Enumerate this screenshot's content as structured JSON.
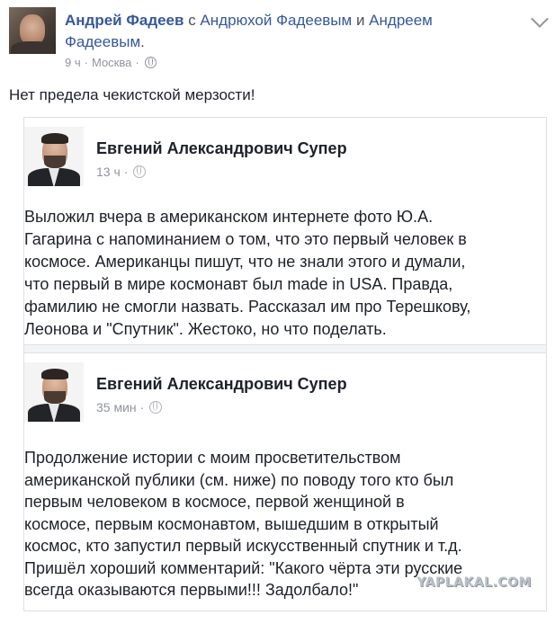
{
  "post": {
    "author": "Андрей Фадеев",
    "with_word": " с ",
    "tagged_1": "Андрюхой Фадеевым",
    "and_word": " и ",
    "tagged_2": "Андреем Фадеевым",
    "period": ".",
    "time": "9 ч",
    "sep": "·",
    "location": "Москва",
    "sep2": "·",
    "text": "Нет предела чекистской мерзости!"
  },
  "shared": [
    {
      "author": "Евгений Александрович Супер",
      "time": "13 ч",
      "sep": "·",
      "text": "Выложил вчера в американском интернете фото Ю.А.\nГагарина с напоминанием о том, что это первый человек в\nкосмосе. Американцы пишут, что не знали этого и думали,\nчто первый в мире космонавт был made in USA. Правда,\nфамилию не смогли назвать. Рассказал им про Терешкову,\nЛеонова и \"Спутник\". Жестоко, но что поделать."
    },
    {
      "author": "Евгений Александрович Супер",
      "time": "35 мин",
      "sep": "·",
      "text": "Продолжение истории с моим просветительством\nамериканской публики (см. ниже) по поводу того кто был\nпервым человеком в космосе, первой женщиной в\nкосмосе, первым космонавтом, вышедшим в открытый\nкосмос, кто запустил первый искусственный спутник и т.д.\nПришёл хороший комментарий: \"Какого чёрта эти русские\nвсегда оказываются первыми!!! Задолбало!\""
    }
  ],
  "watermark": "YAPLAKAL.COM",
  "icons": [
    "globe-icon",
    "chevron-down-icon"
  ],
  "colors": {
    "link": "#365899",
    "meta": "#90949c",
    "text": "#1d2129",
    "border": "#dddfe2"
  }
}
